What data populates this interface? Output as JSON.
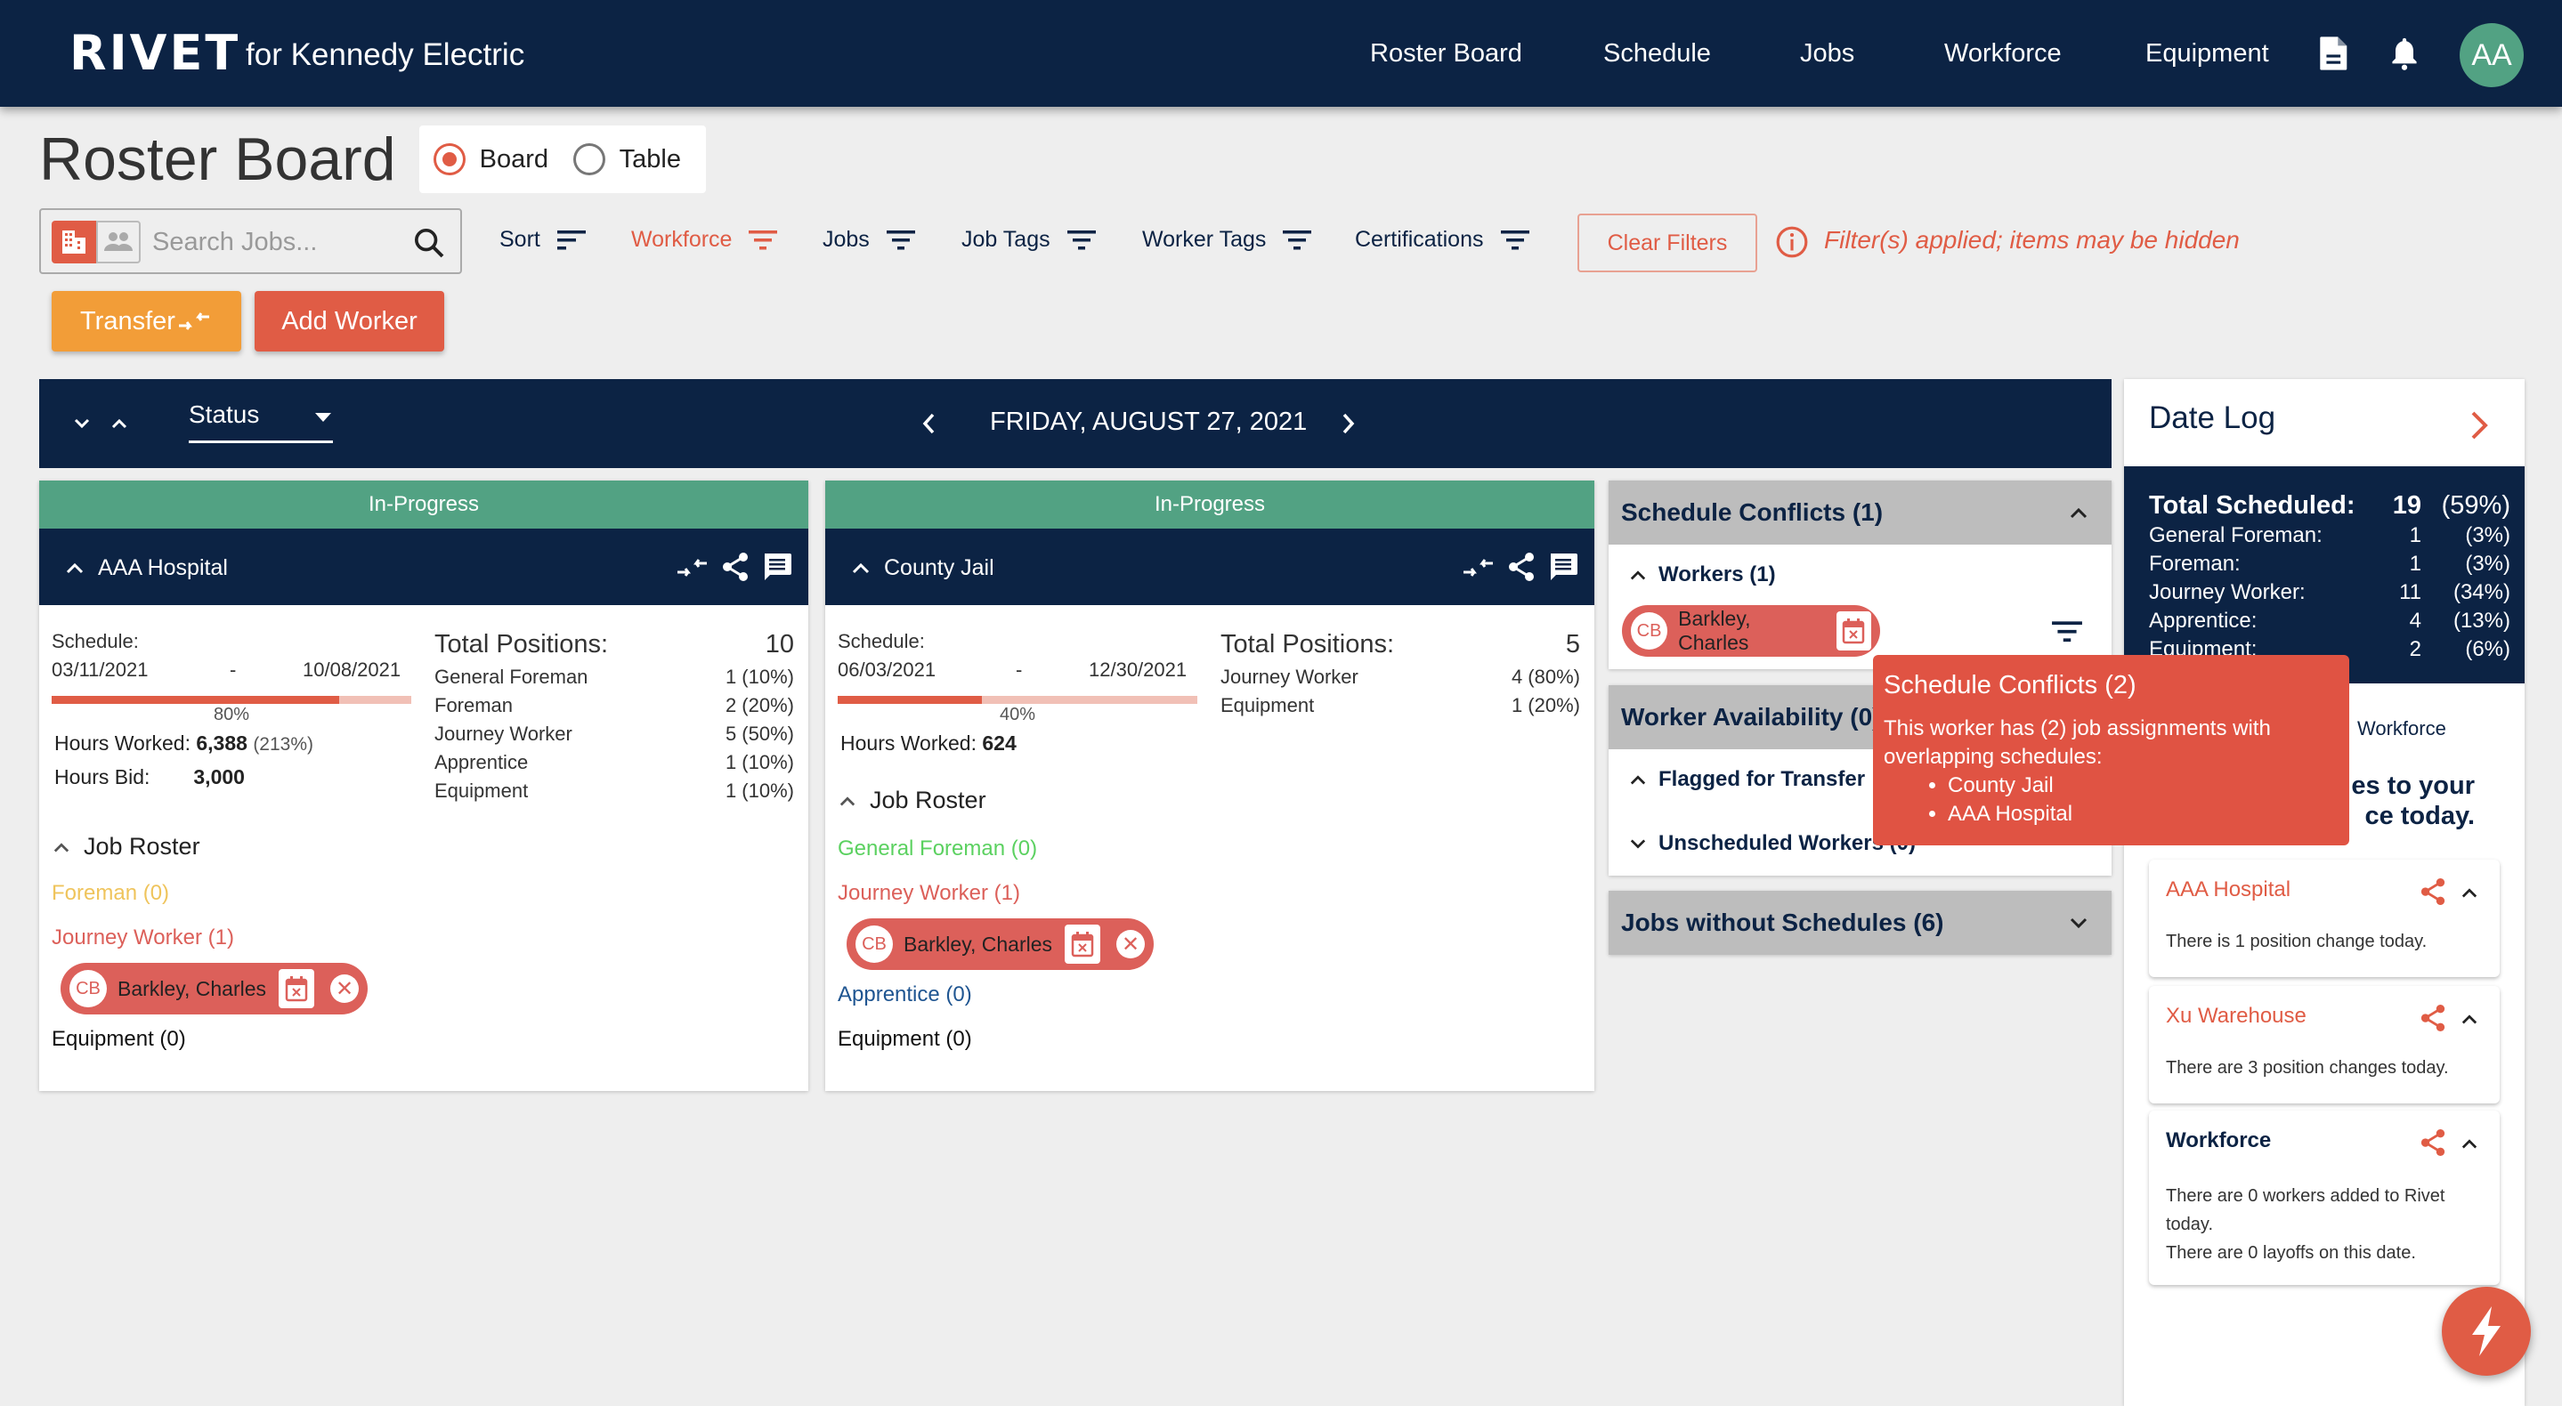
{
  "header": {
    "logo": "RIVET",
    "company": "for Kennedy Electric",
    "nav": [
      "Roster Board",
      "Schedule",
      "Jobs",
      "Workforce",
      "Equipment"
    ],
    "avatar_initials": "AA",
    "icons": [
      "document-icon",
      "bell-icon"
    ]
  },
  "page": {
    "title": "Roster Board",
    "view_options": [
      {
        "label": "Board",
        "selected": true
      },
      {
        "label": "Table",
        "selected": false
      }
    ]
  },
  "toolbar": {
    "search_placeholder": "Search Jobs...",
    "search_value": "",
    "search_mode": "jobs",
    "filters": [
      {
        "label": "Sort",
        "active": false
      },
      {
        "label": "Workforce",
        "active": true
      },
      {
        "label": "Jobs",
        "active": false
      },
      {
        "label": "Job Tags",
        "active": false
      },
      {
        "label": "Worker Tags",
        "active": false
      },
      {
        "label": "Certifications",
        "active": false
      }
    ],
    "clear_filters_label": "Clear Filters",
    "filter_message": "Filter(s) applied; items may be hidden",
    "transfer_label": "Transfer",
    "add_worker_label": "Add Worker"
  },
  "datebar": {
    "status_select": "Status",
    "date": "FRIDAY, AUGUST 27, 2021"
  },
  "jobs": [
    {
      "status": "In-Progress",
      "name": "AAA Hospital",
      "schedule_label": "Schedule:",
      "start": "03/11/2021",
      "dash": "-",
      "end": "10/08/2021",
      "progress_pct": 80,
      "progress_label": "80%",
      "hours_worked_label": "Hours Worked:",
      "hours_worked": "6,388",
      "hours_worked_pct": "(213%)",
      "hours_bid_label": "Hours Bid:",
      "hours_bid": "3,000",
      "total_positions_label": "Total Positions:",
      "total_positions": "10",
      "positions": [
        {
          "role": "General Foreman",
          "value": "1 (10%)"
        },
        {
          "role": "Foreman",
          "value": "2 (20%)"
        },
        {
          "role": "Journey Worker",
          "value": "5 (50%)"
        },
        {
          "role": "Apprentice",
          "value": "1 (10%)"
        },
        {
          "role": "Equipment",
          "value": "1 (10%)"
        }
      ],
      "roster_label": "Job Roster",
      "roster": [
        {
          "label": "Foreman (0)",
          "color": "#efc45c"
        },
        {
          "label": "Journey Worker (1)",
          "color": "#dc605a",
          "workers": [
            {
              "initials": "CB",
              "name": "Barkley, Charles"
            }
          ]
        },
        {
          "label": "Equipment (0)",
          "color": "#111111"
        }
      ]
    },
    {
      "status": "In-Progress",
      "name": "County Jail",
      "schedule_label": "Schedule:",
      "start": "06/03/2021",
      "dash": "-",
      "end": "12/30/2021",
      "progress_pct": 40,
      "progress_label": "40%",
      "hours_worked_label": "Hours Worked:",
      "hours_worked": "624",
      "total_positions_label": "Total Positions:",
      "total_positions": "5",
      "positions": [
        {
          "role": "Journey Worker",
          "value": "4 (80%)"
        },
        {
          "role": "Equipment",
          "value": "1 (20%)"
        }
      ],
      "roster_label": "Job Roster",
      "roster": [
        {
          "label": "General Foreman (0)",
          "color": "#5bd160"
        },
        {
          "label": "Journey Worker (1)",
          "color": "#dc605a",
          "workers": [
            {
              "initials": "CB",
              "name": "Barkley, Charles"
            }
          ]
        },
        {
          "label": "Apprentice (0)",
          "color": "#1f5591"
        },
        {
          "label": "Equipment (0)",
          "color": "#111111"
        }
      ]
    }
  ],
  "side": {
    "schedule_conflicts": {
      "title": "Schedule Conflicts (1)",
      "workers_label": "Workers (1)",
      "worker": {
        "initials": "CB",
        "name": "Barkley, Charles"
      }
    },
    "worker_availability": {
      "title": "Worker Availability (0)",
      "flagged": "Flagged for Transfer",
      "unscheduled": "Unscheduled Workers (0)"
    },
    "jobs_without_schedules": {
      "title": "Jobs without Schedules (6)"
    }
  },
  "tooltip": {
    "title": "Schedule Conflicts (2)",
    "body": "This worker has (2) job assignments with overlapping schedules:",
    "items": [
      "County Jail",
      "AAA Hospital"
    ]
  },
  "datelog": {
    "title": "Date Log",
    "stats": [
      {
        "label": "Total Scheduled:",
        "n": "19",
        "p": "(59%)"
      },
      {
        "label": "General Foreman:",
        "n": "1",
        "p": "(3%)"
      },
      {
        "label": "Foreman:",
        "n": "1",
        "p": "(3%)"
      },
      {
        "label": "Journey Worker:",
        "n": "11",
        "p": "(34%)"
      },
      {
        "label": "Apprentice:",
        "n": "4",
        "p": "(13%)"
      },
      {
        "label": "Equipment:",
        "n": "2",
        "p": "(6%)"
      }
    ],
    "tab_visible": "Workforce",
    "heading_fragment_1": "es to your",
    "heading_fragment_2": "ce today.",
    "cards": [
      {
        "title": "AAA Hospital",
        "style": "orange",
        "lines": [
          "There is 1 position change today."
        ]
      },
      {
        "title": "Xu Warehouse",
        "style": "orange",
        "lines": [
          "There are 3 position changes today."
        ]
      },
      {
        "title": "Workforce",
        "style": "navy",
        "lines": [
          "There are 0 workers added to Rivet today.",
          "There are 0 layoffs on this date."
        ]
      }
    ]
  },
  "colors": {
    "navy": "#0c2344",
    "accent": "#e05c45",
    "status_green": "#52a283",
    "transfer_orange": "#f29d38",
    "chip_red": "#dc605a"
  }
}
